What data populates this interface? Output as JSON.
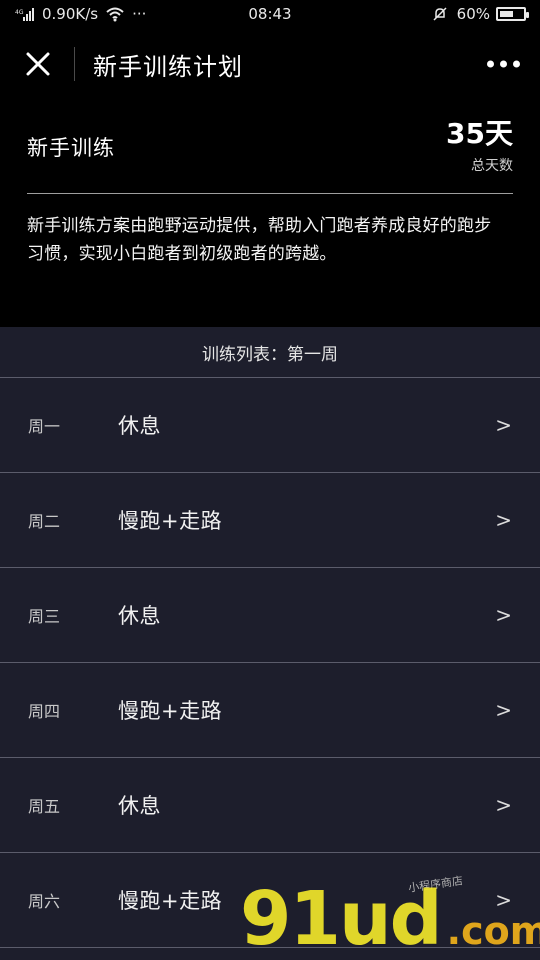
{
  "status_bar": {
    "network_speed": "0.90K/s",
    "time": "08:43",
    "battery": "60%",
    "battery_level": 0.6,
    "signal_label": "4G",
    "more_dots": "···"
  },
  "title_bar": {
    "title": "新手训练计划",
    "close_icon": "close-icon",
    "more_icon": "more-icon"
  },
  "hero": {
    "name": "新手训练",
    "days_number": "35天",
    "days_label": "总天数",
    "description": "新手训练方案由跑野运动提供，帮助入门跑者养成良好的跑步习惯，实现小白跑者到初级跑者的跨越。"
  },
  "list": {
    "header": "训练列表：第一周",
    "rows": [
      {
        "day": "周一",
        "activity": "休息",
        "arrow": ">"
      },
      {
        "day": "周二",
        "activity": "慢跑+走路",
        "arrow": ">"
      },
      {
        "day": "周三",
        "activity": "休息",
        "arrow": ">"
      },
      {
        "day": "周四",
        "activity": "慢跑+走路",
        "arrow": ">"
      },
      {
        "day": "周五",
        "activity": "休息",
        "arrow": ">"
      },
      {
        "day": "周六",
        "activity": "慢跑+走路",
        "arrow": ">"
      }
    ]
  },
  "watermark": {
    "main": "91ud",
    "suffix": ".com",
    "small": "小程序商店"
  },
  "colors": {
    "background": "#000000",
    "list_background": "#1d1e2c",
    "divider": "#5b5c6b",
    "watermark_main": "#f1e62a",
    "watermark_com": "#f0b11b"
  }
}
